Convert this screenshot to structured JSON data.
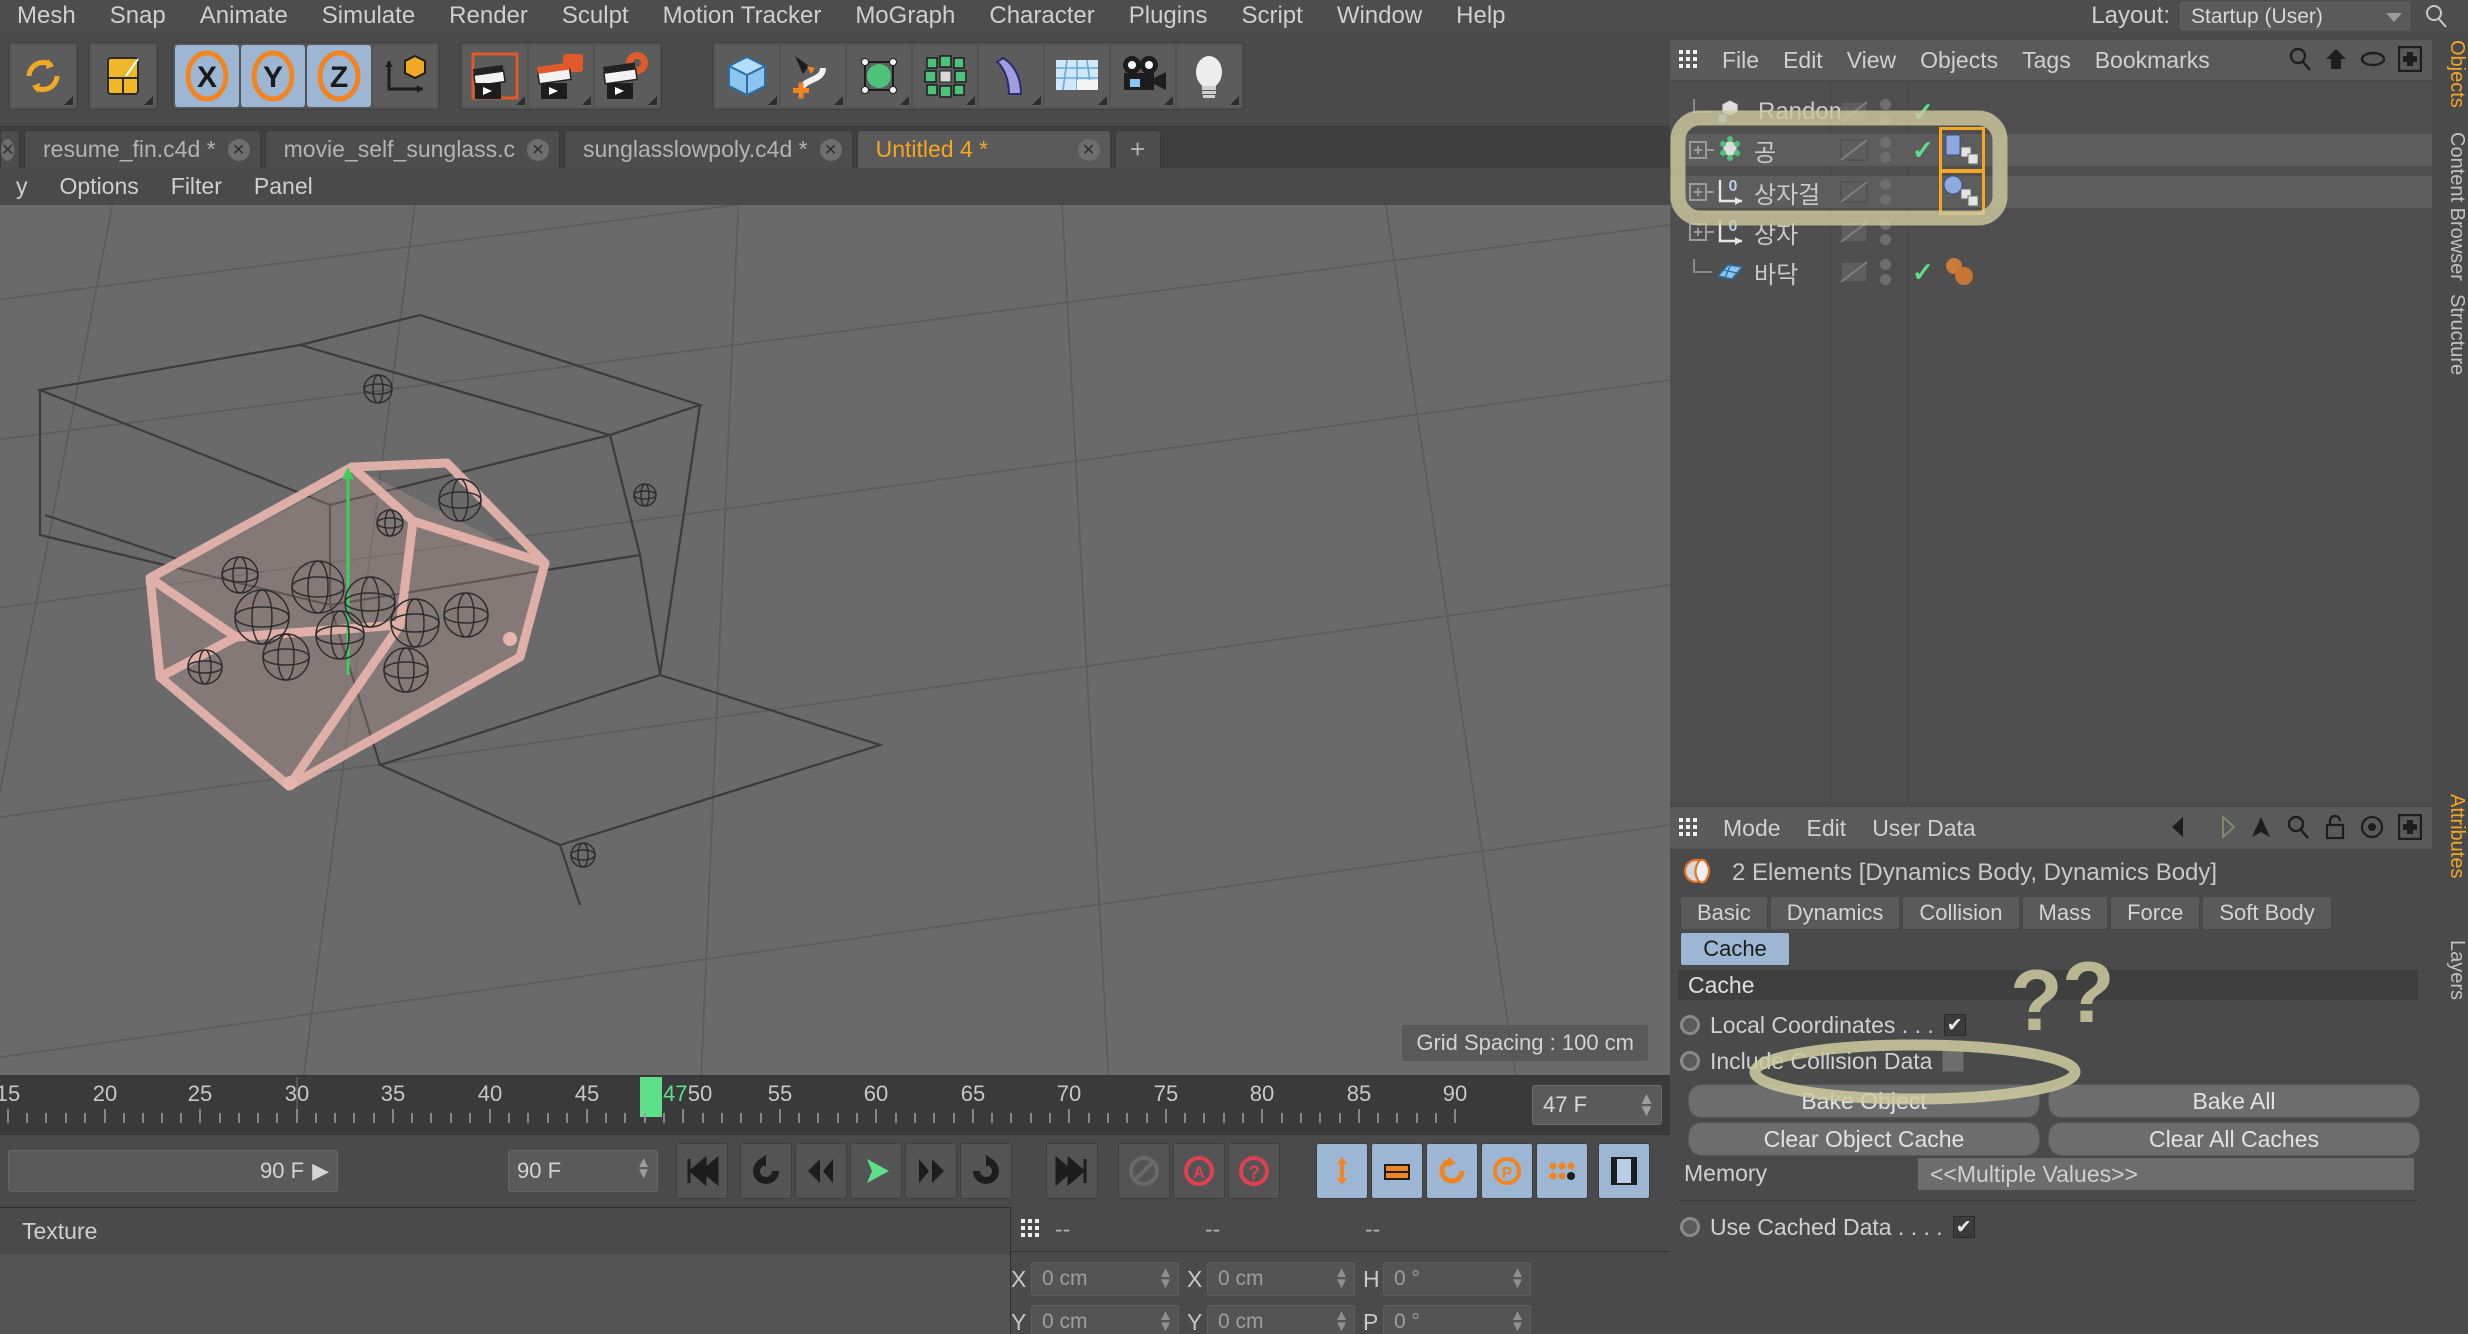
{
  "menubar": {
    "items": [
      "Mesh",
      "Snap",
      "Animate",
      "Simulate",
      "Render",
      "Sculpt",
      "Motion Tracker",
      "MoGraph",
      "Character",
      "Plugins",
      "Script",
      "Window",
      "Help"
    ],
    "layout_label": "Layout:",
    "layout_value": "Startup (User)",
    "search_icon": "search-icon"
  },
  "toolbar": {
    "groups": [
      {
        "name": "undo-redo",
        "buttons": [
          {
            "icon": "undo-redo-icon"
          }
        ]
      },
      {
        "name": "select",
        "buttons": [
          {
            "icon": "live-selection-icon"
          }
        ]
      },
      {
        "name": "axis-locks",
        "buttons": [
          {
            "icon": "x-axis-icon",
            "label": "X",
            "active": true
          },
          {
            "icon": "y-axis-icon",
            "label": "Y",
            "active": true
          },
          {
            "icon": "z-axis-icon",
            "label": "Z",
            "active": true
          },
          {
            "icon": "world-object-coord-icon"
          }
        ]
      },
      {
        "name": "render",
        "buttons": [
          {
            "icon": "render-view-icon"
          },
          {
            "icon": "render-region-icon"
          },
          {
            "icon": "render-settings-icon"
          }
        ]
      },
      {
        "name": "primitives",
        "buttons": [
          {
            "icon": "cube-primitive-icon"
          },
          {
            "icon": "spline-pen-icon"
          },
          {
            "icon": "subdivision-surface-icon"
          },
          {
            "icon": "mograph-cloner-icon"
          },
          {
            "icon": "bend-deformer-icon"
          },
          {
            "icon": "floor-environment-icon"
          },
          {
            "icon": "camera-icon"
          },
          {
            "icon": "light-icon"
          }
        ]
      }
    ]
  },
  "document_tabs": {
    "tabs": [
      {
        "title": "resume_fin.c4d *",
        "active": false,
        "close_icon": "close-icon"
      },
      {
        "title": "movie_self_sunglass.c",
        "active": false,
        "close_icon": "close-icon"
      },
      {
        "title": "sunglasslowpoly.c4d *",
        "active": false,
        "close_icon": "close-icon"
      },
      {
        "title": "Untitled 4 *",
        "active": true,
        "close_icon": "close-icon"
      }
    ],
    "new_tab_label": "+"
  },
  "viewport": {
    "menu": [
      "Options",
      "Filter",
      "Panel"
    ],
    "grid_spacing": "Grid Spacing : 100 cm",
    "nav_icons": [
      "move-view-icon",
      "scale-view-icon",
      "rotate-view-icon",
      "panel-layout-icon"
    ]
  },
  "timeline": {
    "ticks": [
      "15",
      "20",
      "25",
      "30",
      "35",
      "40",
      "45",
      "50",
      "55",
      "60",
      "65",
      "70",
      "75",
      "80",
      "85",
      "90"
    ],
    "current_frame_marker": "47",
    "current_frame_field": "47 F",
    "start_field": "90 F",
    "end_field": "90 F",
    "transport": [
      {
        "icon": "go-to-start-icon"
      },
      {
        "icon": "loop-icon"
      },
      {
        "icon": "step-back-icon"
      },
      {
        "icon": "play-icon"
      },
      {
        "icon": "step-forward-icon"
      },
      {
        "icon": "go-to-end-reverse-icon"
      },
      {
        "icon": "go-to-end-icon"
      }
    ],
    "record_group": [
      {
        "icon": "record-disabled-icon"
      },
      {
        "icon": "autokey-icon"
      },
      {
        "icon": "keyframe-help-icon"
      }
    ],
    "key_group": [
      {
        "icon": "position-key-icon"
      },
      {
        "icon": "scale-key-icon"
      },
      {
        "icon": "rotation-key-icon"
      },
      {
        "icon": "param-key-icon"
      },
      {
        "icon": "pla-key-icon"
      }
    ],
    "extra": [
      {
        "icon": "timeline-icon"
      }
    ]
  },
  "material_manager": {
    "menu_label": "Texture"
  },
  "coordinates": {
    "header_values": [
      "--",
      "--",
      "--"
    ],
    "rows": [
      {
        "labels": [
          "X",
          "X",
          "H"
        ],
        "values": [
          "0 cm",
          "0 cm",
          "0 °"
        ]
      },
      {
        "labels": [
          "Y",
          "Y",
          "P"
        ],
        "values": [
          "0 cm",
          "0 cm",
          "0 °"
        ]
      }
    ]
  },
  "object_manager": {
    "menu": [
      "File",
      "Edit",
      "View",
      "Objects",
      "Tags",
      "Bookmarks"
    ],
    "icons": [
      "search-icon",
      "home-icon",
      "eye-icon",
      "add-layer-icon"
    ],
    "rows": [
      {
        "name": "Random",
        "object_icon": "mograph-random-effector-icon",
        "expandable": false,
        "visibility_top": "dot",
        "visibility_bottom": "dot",
        "enabled_check": true,
        "tags": []
      },
      {
        "name": "공",
        "object_icon": "mograph-cloner-icon",
        "expandable": true,
        "visibility_top": "dot",
        "visibility_bottom": "dot",
        "enabled_check": true,
        "tags": [
          {
            "icon": "dynamics-body-tag-icon",
            "selected": true
          }
        ],
        "highlighted": true
      },
      {
        "name": "상자걸",
        "object_icon": "null-object-icon",
        "expandable": true,
        "visibility_top": "dot",
        "visibility_bottom": "dot",
        "enabled_check": false,
        "tags": [
          {
            "icon": "dynamics-body-tag-icon",
            "selected": true
          }
        ],
        "highlighted": true
      },
      {
        "name": "상자",
        "object_icon": "null-object-icon",
        "expandable": true,
        "visibility_top": "dot",
        "visibility_bottom": "dot",
        "enabled_check": false,
        "tags": []
      },
      {
        "name": "바닥",
        "object_icon": "floor-plane-icon",
        "expandable": false,
        "visibility_top": "dot",
        "visibility_bottom": "dot",
        "enabled_check": true,
        "tags": [
          {
            "icon": "material-tag-icon",
            "selected": false
          }
        ]
      }
    ]
  },
  "attribute_manager": {
    "menu": [
      "Mode",
      "Edit",
      "User Data"
    ],
    "icons": [
      "nav-back-icon",
      "nav-forward-icon",
      "nav-up-icon",
      "search-icon",
      "lock-icon",
      "target-icon",
      "add-icon"
    ],
    "title": "2 Elements [Dynamics Body, Dynamics Body]",
    "title_icon": "dynamics-body-tag-icon",
    "tabs": [
      "Basic",
      "Dynamics",
      "Collision",
      "Mass",
      "Force",
      "Soft Body"
    ],
    "tabs_row2": [
      "Cache"
    ],
    "active_tab": "Cache",
    "section_title": "Cache",
    "properties": [
      {
        "label": "Local Coordinates . . .",
        "type": "checkbox",
        "checked": true
      },
      {
        "label": "Include Collision Data",
        "type": "checkbox",
        "checked": false
      }
    ],
    "buttons": [
      {
        "label": "Bake Object",
        "highlighted": true
      },
      {
        "label": "Bake All",
        "highlighted": false
      },
      {
        "label": "Clear Object Cache",
        "highlighted": false
      },
      {
        "label": "Clear All Caches",
        "highlighted": false
      }
    ],
    "memory_label": "Memory",
    "memory_value": "<<Multiple Values>>",
    "use_cached": {
      "label": "Use Cached Data . . . .",
      "type": "checkbox",
      "checked": true
    }
  },
  "vertical_tabs": [
    {
      "label": "Objects",
      "accent": true
    },
    {
      "label": "Content Browser",
      "accent": false
    },
    {
      "label": "Structure",
      "accent": false
    },
    {
      "label": "Attributes",
      "accent": true
    },
    {
      "label": "Layers",
      "accent": false
    }
  ],
  "annotations": {
    "color": "#cfcba0",
    "marks": [
      "object-rows-highlight-box",
      "question-marks",
      "bake-object-circle"
    ]
  },
  "colors": {
    "accent_orange": "#f5a623",
    "tab_blue": "#9db6d4",
    "check_green": "#5ee08a",
    "panel_bg": "#4a4a4a",
    "viewport_bg": "#6a6a6a",
    "annotation": "#cfcba0"
  }
}
